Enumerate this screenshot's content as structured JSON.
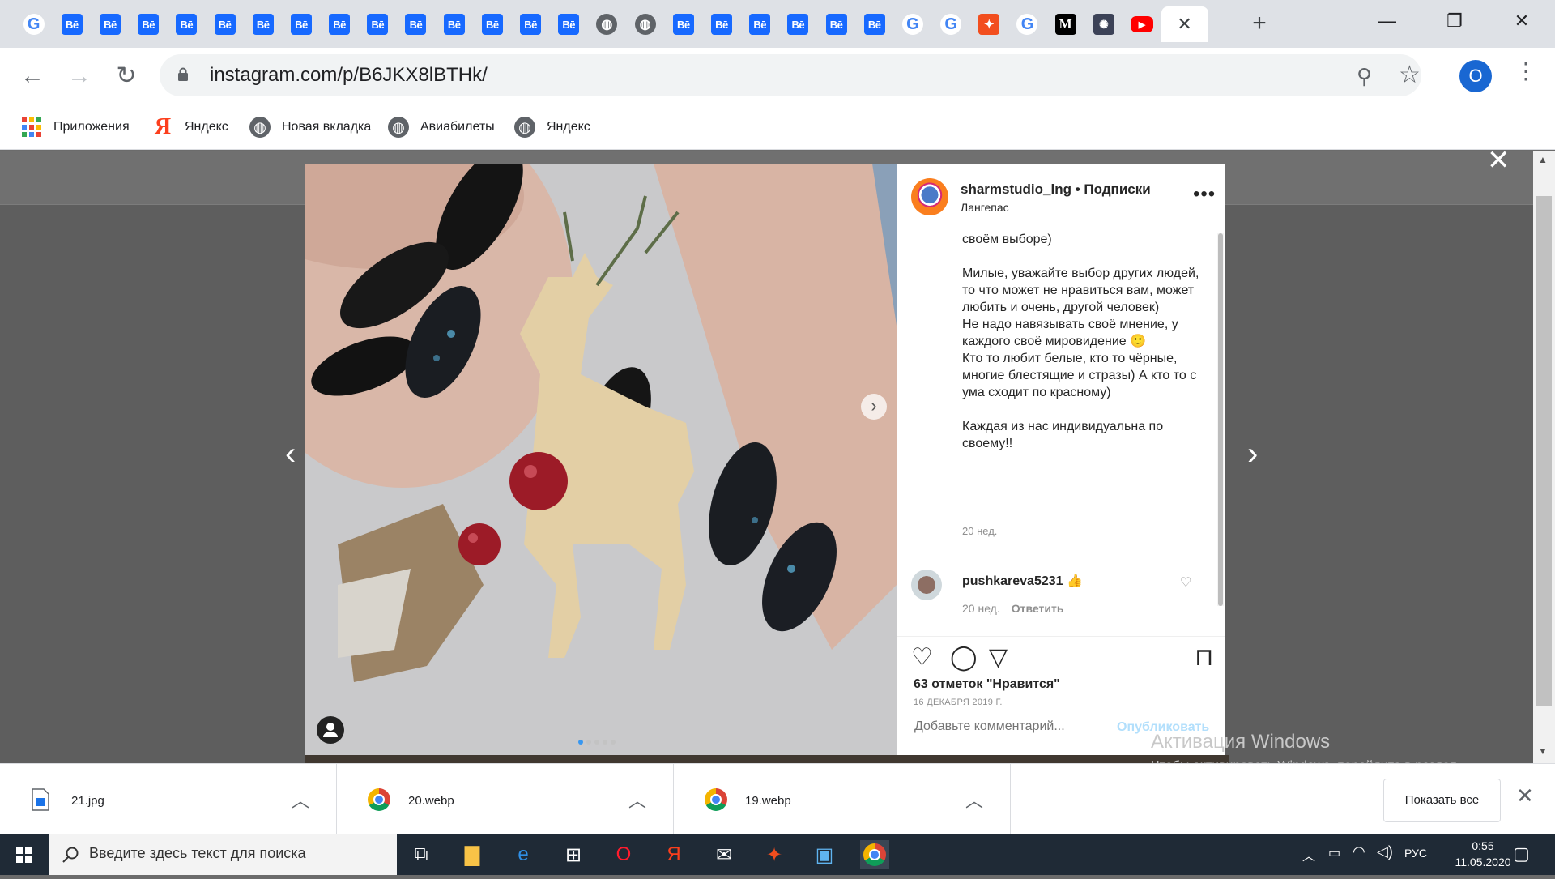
{
  "browser": {
    "tabs": [
      {
        "icon": "google-icon",
        "glyph": "G",
        "kind": "google"
      },
      {
        "icon": "behance-icon",
        "glyph": "Bē",
        "kind": "behance"
      },
      {
        "icon": "behance-icon",
        "glyph": "Bē",
        "kind": "behance"
      },
      {
        "icon": "behance-icon",
        "glyph": "Bē",
        "kind": "behance"
      },
      {
        "icon": "behance-icon",
        "glyph": "Bē",
        "kind": "behance"
      },
      {
        "icon": "behance-icon",
        "glyph": "Bē",
        "kind": "behance"
      },
      {
        "icon": "behance-icon",
        "glyph": "Bē",
        "kind": "behance"
      },
      {
        "icon": "behance-icon",
        "glyph": "Bē",
        "kind": "behance"
      },
      {
        "icon": "behance-icon",
        "glyph": "Bē",
        "kind": "behance"
      },
      {
        "icon": "behance-icon",
        "glyph": "Bē",
        "kind": "behance"
      },
      {
        "icon": "behance-icon",
        "glyph": "Bē",
        "kind": "behance"
      },
      {
        "icon": "behance-icon",
        "glyph": "Bē",
        "kind": "behance"
      },
      {
        "icon": "behance-icon",
        "glyph": "Bē",
        "kind": "behance"
      },
      {
        "icon": "behance-icon",
        "glyph": "Bē",
        "kind": "behance"
      },
      {
        "icon": "behance-icon",
        "glyph": "Bē",
        "kind": "behance"
      },
      {
        "icon": "globe-icon",
        "glyph": "◍",
        "kind": "globe"
      },
      {
        "icon": "globe-icon",
        "glyph": "◍",
        "kind": "globe"
      },
      {
        "icon": "behance-icon",
        "glyph": "Bē",
        "kind": "behance"
      },
      {
        "icon": "behance-icon",
        "glyph": "Bē",
        "kind": "behance"
      },
      {
        "icon": "behance-icon",
        "glyph": "Bē",
        "kind": "behance"
      },
      {
        "icon": "behance-icon",
        "glyph": "Bē",
        "kind": "behance"
      },
      {
        "icon": "behance-icon",
        "glyph": "Bē",
        "kind": "behance"
      },
      {
        "icon": "behance-icon",
        "glyph": "Bē",
        "kind": "behance"
      },
      {
        "icon": "google-icon",
        "glyph": "G",
        "kind": "google"
      },
      {
        "icon": "google-icon",
        "glyph": "G",
        "kind": "google"
      },
      {
        "icon": "figma-icon",
        "glyph": "✦",
        "kind": "figma"
      },
      {
        "icon": "google-icon",
        "glyph": "G",
        "kind": "google"
      },
      {
        "icon": "medium-icon",
        "glyph": "M",
        "kind": "medium"
      },
      {
        "icon": "dark-app-icon",
        "glyph": "✺",
        "kind": "dark"
      },
      {
        "icon": "youtube-icon",
        "glyph": "▶",
        "kind": "youtube"
      }
    ],
    "url": "instagram.com/p/B6JKX8lBTHk/",
    "profile_initial": "O",
    "bookmarks": [
      {
        "label": "Приложения",
        "icon": "apps-grid-icon"
      },
      {
        "label": "Яндекс",
        "icon": "yandex-icon"
      },
      {
        "label": "Новая вкладка",
        "icon": "globe-icon"
      },
      {
        "label": "Авиабилеты",
        "icon": "globe-icon"
      },
      {
        "label": "Яндекс",
        "icon": "globe-icon"
      }
    ]
  },
  "post": {
    "username": "sharmstudio_lng",
    "separator": " • ",
    "follow_status": "Подписки",
    "location": "Лангепас",
    "caption_paragraphs": [
      "ни у кого, а получила такой вот отзыв о своём выборе)",
      "Милые, уважайте выбор других людей, то что может не нравиться вам, может любить и очень, другой человек)\nНе надо навязывать своё мнение, у каждого своё мировидение 🙂\nКто то любит белые, кто то чёрные, многие блестящие и стразы) А кто то с ума сходит по красному)",
      "Каждая из нас индивидуальна по своему!!"
    ],
    "caption_time": "20 нед.",
    "comment": {
      "username": "pushkareva5231",
      "emoji": "👍",
      "time": "20 нед.",
      "reply_label": "Ответить"
    },
    "likes": "63 отметок \"Нравится\"",
    "date": "16 ДЕКАБРЯ 2019 Г.",
    "comment_placeholder": "Добавьте комментарий...",
    "publish_label": "Опубликовать"
  },
  "windows_activation": {
    "title": "Активация Windows",
    "subtitle": "Чтобы активировать Windows, перейдите в раздел \"Параметры\"."
  },
  "downloads": {
    "items": [
      {
        "name": "21.jpg",
        "icon": "image-file-icon"
      },
      {
        "name": "20.webp",
        "icon": "chrome-file-icon"
      },
      {
        "name": "19.webp",
        "icon": "chrome-file-icon"
      }
    ],
    "show_all_label": "Показать все"
  },
  "taskbar": {
    "search_placeholder": "Введите здесь текст для поиска",
    "language": "РУС",
    "time": "0:55",
    "date": "11.05.2020"
  },
  "colors": {
    "instagram_link": "#3897f0",
    "publish_disabled": "#b2dffc",
    "behance": "#1769ff",
    "youtube": "#ff0000"
  }
}
